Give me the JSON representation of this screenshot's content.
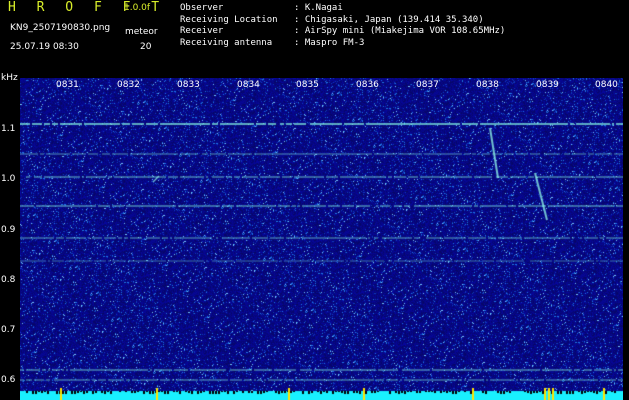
{
  "header": {
    "app_title": "H R O F F T",
    "version": "1.0.0f",
    "filename": "KN9_2507190830.png",
    "mode": "meteor",
    "datetime": "25.07.19 08:30",
    "interval": "20"
  },
  "info": [
    {
      "label": "Observer",
      "value": ": K.Nagai"
    },
    {
      "label": "Receiving Location",
      "value": ": Chigasaki, Japan (139.414 35.340)"
    },
    {
      "label": "Receiver",
      "value": ": AirSpy mini (Miakejima VOR 108.65MHz)"
    },
    {
      "label": "Receiving antenna",
      "value": ": Maspro FM-3"
    }
  ],
  "axis": {
    "y_unit": "kHz",
    "y_ticks": [
      "1.1",
      "1.0",
      "0.9",
      "0.8",
      "0.7",
      "0.6"
    ],
    "x_ticks": [
      "0831",
      "0832",
      "0833",
      "0834",
      "0835",
      "0836",
      "0837",
      "0838",
      "0839",
      "0840"
    ]
  },
  "colors": {
    "title": "#d9ee2a",
    "background": "#000000",
    "noise_base": "#0a0a8c",
    "carrier": "#7ff0e0",
    "bottom_band": "#19f0ff",
    "bottom_peak": "#ffe600"
  }
}
